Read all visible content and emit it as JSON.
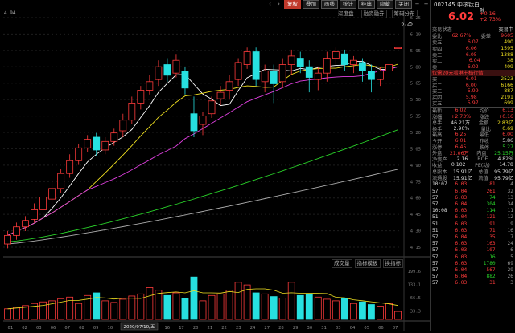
{
  "toolbar": {
    "buttons": [
      "复权",
      "叠加",
      "画线",
      "统计",
      "经典",
      "隐藏",
      "关闭"
    ],
    "active": "复权"
  },
  "chart_tabs": [
    "深度盘",
    "融资融券",
    "筹码分布"
  ],
  "hover_label": "4.94",
  "high_mark": "6.25",
  "date_tooltip": "2020/07/10/五",
  "price_axis": [
    "6.25",
    "6.10",
    "5.95",
    "5.80",
    "5.65",
    "5.50",
    "5.35",
    "5.20",
    "5.05",
    "4.90",
    "4.75",
    "4.60",
    "4.45",
    "4.30",
    "4.15"
  ],
  "volume_axis": [
    "199.6",
    "133.1",
    "66.5",
    "33.3"
  ],
  "volume_tabs": [
    "成交量",
    "指标模板",
    "换指标"
  ],
  "x_dates": [
    "01",
    "02",
    "03",
    "06",
    "07",
    "08",
    "09",
    "10",
    "13",
    "14",
    "15",
    "16",
    "17",
    "20",
    "21",
    "22",
    "23",
    "24",
    "27",
    "28",
    "29",
    "30",
    "31",
    "03",
    "04",
    "05",
    "06",
    "07"
  ],
  "colors": {
    "up": "#ff3b3b",
    "down": "#27e0e0",
    "ma5": "#ffffff",
    "ma10": "#f0e020",
    "ma20": "#e040e0",
    "ma60": "#29d129",
    "ma120": "#aaaaaa"
  },
  "quote": {
    "code": "002145 中核钛白",
    "badge": "融",
    "price": "6.02",
    "change": "+0.16",
    "change_pct": "+2.73%",
    "status_left": "交易状态",
    "status_right": "交易中",
    "ratio_label": "委比",
    "ratio_value": "62.67%",
    "diff_label": "委差",
    "diff_value": "9605",
    "ask": [
      {
        "label": "卖五",
        "price": "6.07",
        "vol": "490"
      },
      {
        "label": "卖四",
        "price": "6.06",
        "vol": "1595"
      },
      {
        "label": "卖三",
        "price": "6.05",
        "vol": "1388"
      },
      {
        "label": "卖二",
        "price": "6.04",
        "vol": "38"
      },
      {
        "label": "卖一",
        "price": "6.02",
        "vol": "409"
      }
    ],
    "level_banner": "仅需20元看港十档行情",
    "bid": [
      {
        "label": "买一",
        "price": "6.01",
        "vol": "2523"
      },
      {
        "label": "买二",
        "price": "6.00",
        "vol": "6166"
      },
      {
        "label": "买三",
        "price": "5.99",
        "vol": "887"
      },
      {
        "label": "买四",
        "price": "5.98",
        "vol": "2191"
      },
      {
        "label": "买五",
        "price": "5.97",
        "vol": "699"
      }
    ],
    "stats": [
      {
        "l1": "最新",
        "v1": "6.02",
        "c1": "red",
        "l2": "均价",
        "v2": "6.13",
        "c2": "red"
      },
      {
        "l1": "涨幅",
        "v1": "+2.73%",
        "c1": "red",
        "l2": "涨跌",
        "v2": "+0.16",
        "c2": "red"
      },
      {
        "l1": "总手",
        "v1": "46.21万",
        "c1": "white",
        "l2": "金额",
        "v2": "2.83亿",
        "c2": "yellow"
      },
      {
        "l1": "换手",
        "v1": "2.90%",
        "c1": "white",
        "l2": "量比",
        "v2": "0.69",
        "c2": "yellow"
      },
      {
        "l1": "最高",
        "v1": "6.25",
        "c1": "red",
        "l2": "最低",
        "v2": "6.00",
        "c2": "red"
      },
      {
        "l1": "今开",
        "v1": "6.01",
        "c1": "red",
        "l2": "昨收",
        "v2": "5.86",
        "c2": "white"
      },
      {
        "l1": "涨停",
        "v1": "6.45",
        "c1": "red",
        "l2": "跌停",
        "v2": "5.27",
        "c2": "green"
      },
      {
        "l1": "外盘",
        "v1": "21.06万",
        "c1": "red",
        "l2": "内盘",
        "v2": "25.15万",
        "c2": "green"
      },
      {
        "l1": "净资产",
        "v1": "2.16",
        "c1": "white",
        "l2": "ROE",
        "v2": "4.82%",
        "c2": "white"
      },
      {
        "l1": "收益",
        "v1": "0.102",
        "c1": "white",
        "l2": "PE(动)",
        "v2": "14.78",
        "c2": "white"
      },
      {
        "l1": "总股本",
        "v1": "15.91亿",
        "c1": "white",
        "l2": "总值",
        "v2": "95.79亿",
        "c2": "white"
      },
      {
        "l1": "流通股",
        "v1": "15.91亿",
        "c1": "white",
        "l2": "流值",
        "v2": "95.79亿",
        "c2": "white"
      }
    ],
    "ticks": [
      {
        "t": "10:07",
        "p": "6.03",
        "v": "81",
        "n": "4"
      },
      {
        "t": "57",
        "p": "6.04",
        "v": "261",
        "n": "32"
      },
      {
        "t": "57",
        "p": "6.03",
        "v": "74",
        "n": "13"
      },
      {
        "t": "57",
        "p": "6.04",
        "v": "304",
        "n": "34"
      },
      {
        "t": "10:08",
        "p": "6.03",
        "v": "114",
        "n": "11"
      },
      {
        "t": "51",
        "p": "6.04",
        "v": "121",
        "n": "12"
      },
      {
        "t": "51",
        "p": "6.03",
        "v": "91",
        "n": "9"
      },
      {
        "t": "51",
        "p": "6.03",
        "v": "71",
        "n": "16"
      },
      {
        "t": "57",
        "p": "6.04",
        "v": "35",
        "n": "7"
      },
      {
        "t": "57",
        "p": "6.03",
        "v": "163",
        "n": "24"
      },
      {
        "t": "57",
        "p": "6.03",
        "v": "107",
        "n": "6"
      },
      {
        "t": "57",
        "p": "6.03",
        "v": "16",
        "n": "5"
      },
      {
        "t": "57",
        "p": "6.03",
        "v": "1780",
        "n": "69"
      },
      {
        "t": "57",
        "p": "6.04",
        "v": "567",
        "n": "29"
      },
      {
        "t": "57",
        "p": "6.04",
        "v": "882",
        "n": "26"
      },
      {
        "t": "57",
        "p": "6.03",
        "v": "31",
        "n": "3"
      }
    ]
  },
  "chart_data": {
    "type": "candlestick",
    "ylim": [
      4.15,
      6.3
    ],
    "candles": [
      [
        4.18,
        4.26,
        4.14,
        4.3
      ],
      [
        4.26,
        4.34,
        4.22,
        4.38
      ],
      [
        4.34,
        4.4,
        4.3,
        4.44
      ],
      [
        4.41,
        4.5,
        4.38,
        4.56
      ],
      [
        4.5,
        4.62,
        4.46,
        4.66
      ],
      [
        4.6,
        4.7,
        4.55,
        4.78
      ],
      [
        4.7,
        4.84,
        4.66,
        4.88
      ],
      [
        4.84,
        4.96,
        4.8,
        5.02
      ],
      [
        4.96,
        5.08,
        4.92,
        5.12
      ],
      [
        5.08,
        5.16,
        5.04,
        5.2
      ],
      [
        5.18,
        5.06,
        5.0,
        5.22
      ],
      [
        5.06,
        5.14,
        5.02,
        5.18
      ],
      [
        5.14,
        5.22,
        5.1,
        5.26
      ],
      [
        5.24,
        5.34,
        5.18,
        5.4
      ],
      [
        5.34,
        5.5,
        5.3,
        5.56
      ],
      [
        5.5,
        5.62,
        5.44,
        5.66
      ],
      [
        5.62,
        5.7,
        5.58,
        5.76
      ],
      [
        5.72,
        5.84,
        5.66,
        5.9
      ],
      [
        5.86,
        5.76,
        5.7,
        5.92
      ],
      [
        5.78,
        5.9,
        5.74,
        5.96
      ],
      [
        5.8,
        5.64,
        5.58,
        5.84
      ],
      [
        5.4,
        5.24,
        5.18,
        5.56
      ],
      [
        5.3,
        5.38,
        5.2,
        5.42
      ],
      [
        5.4,
        5.52,
        5.36,
        5.56
      ],
      [
        5.54,
        5.6,
        5.48,
        5.66
      ],
      [
        5.62,
        5.7,
        5.54,
        5.76
      ],
      [
        5.72,
        5.88,
        5.66,
        5.92
      ],
      [
        5.86,
        5.98,
        5.82,
        6.02
      ],
      [
        5.98,
        5.72,
        5.66,
        6.02
      ],
      [
        5.7,
        5.8,
        5.6,
        5.86
      ],
      [
        5.8,
        5.68,
        5.5,
        5.86
      ],
      [
        5.7,
        5.86,
        5.64,
        5.92
      ],
      [
        5.86,
        5.94,
        5.76,
        6.0
      ],
      [
        5.92,
        5.84,
        5.78,
        5.98
      ],
      [
        5.84,
        5.74,
        5.6,
        5.9
      ],
      [
        5.72,
        5.78,
        5.62,
        5.84
      ],
      [
        5.78,
        5.92,
        5.7,
        5.98
      ],
      [
        5.92,
        5.98,
        5.86,
        6.02
      ],
      [
        5.96,
        5.86,
        5.8,
        6.0
      ],
      [
        5.86,
        5.9,
        5.78,
        5.94
      ],
      [
        5.88,
        5.8,
        5.7,
        5.92
      ],
      [
        5.8,
        5.72,
        5.6,
        5.86
      ],
      [
        5.72,
        5.8,
        5.66,
        5.84
      ],
      [
        5.8,
        5.86,
        5.74,
        5.9
      ],
      [
        6.01,
        6.02,
        6.0,
        6.25
      ]
    ],
    "volumes": [
      40,
      46,
      52,
      60,
      66,
      70,
      78,
      84,
      60,
      90,
      100,
      70,
      64,
      76,
      88,
      96,
      120,
      110,
      90,
      100,
      80,
      160,
      70,
      90,
      96,
      110,
      140,
      130,
      100,
      96,
      86,
      80,
      140,
      90,
      96,
      84,
      76,
      70,
      80,
      60,
      66,
      56,
      50,
      60,
      30
    ]
  }
}
